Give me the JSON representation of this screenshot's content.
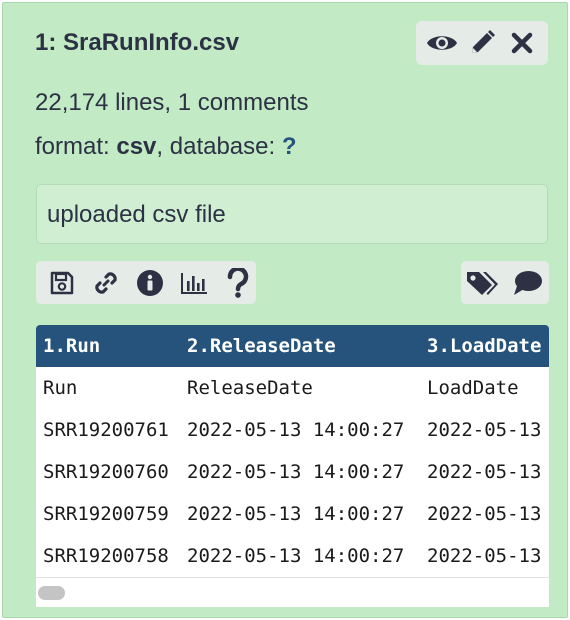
{
  "dataset": {
    "title": "1: SraRunInfo.csv",
    "lines_text": "22,174 lines, 1 comments",
    "format_label": "format: ",
    "format_value": "csv",
    "database_label": ", database: ",
    "database_value": "?",
    "annotation": "uploaded csv file"
  },
  "title_actions": [
    "eye-icon",
    "pencil-icon",
    "close-icon"
  ],
  "toolbar": {
    "left": [
      "floppy-disk-icon",
      "link-icon",
      "info-icon",
      "bar-chart-icon",
      "question-icon"
    ],
    "right": [
      "tags-icon",
      "comment-icon"
    ]
  },
  "table": {
    "headers": [
      "1.Run",
      "2.ReleaseDate",
      "3.LoadDate"
    ],
    "rows": [
      [
        "Run",
        "ReleaseDate",
        "LoadDate"
      ],
      [
        "SRR19200761",
        "2022-05-13 14:00:27",
        "2022-05-13"
      ],
      [
        "SRR19200760",
        "2022-05-13 14:00:27",
        "2022-05-13"
      ],
      [
        "SRR19200759",
        "2022-05-13 14:00:27",
        "2022-05-13"
      ],
      [
        "SRR19200758",
        "2022-05-13 14:00:27",
        "2022-05-13"
      ]
    ]
  },
  "colors": {
    "panel_bg": "#c2ebc5",
    "header_bg": "#25537b",
    "text": "#2c3143"
  }
}
